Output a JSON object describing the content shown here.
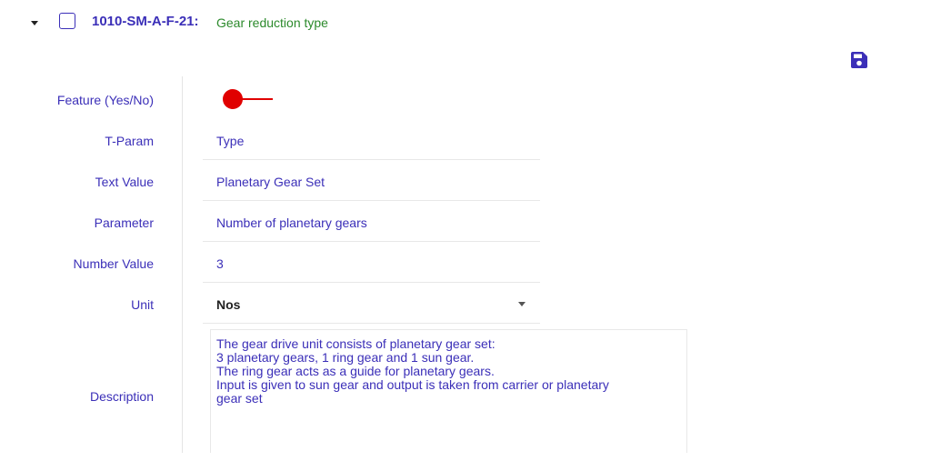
{
  "header": {
    "code": "1010-SM-A-F-21:",
    "title": "Gear reduction type"
  },
  "icons": {
    "expand": "caret-down-icon",
    "save": "floppy-disk-icon"
  },
  "colors": {
    "accent": "#3b2fb8",
    "title_green": "#2c8a2c",
    "toggle_off": "#e00000"
  },
  "form": {
    "feature": {
      "label": "Feature (Yes/No)",
      "value": false
    },
    "t_param": {
      "label": "T-Param",
      "value": "Type"
    },
    "text_value": {
      "label": "Text Value",
      "value": "Planetary Gear Set"
    },
    "parameter": {
      "label": "Parameter",
      "value": "Number of planetary gears"
    },
    "number_value": {
      "label": "Number Value",
      "value": "3"
    },
    "unit": {
      "label": "Unit",
      "value": "Nos"
    },
    "description": {
      "label": "Description",
      "value": "The gear drive unit consists of planetary gear set:\n3 planetary gears, 1 ring gear and 1 sun gear.\nThe ring gear acts as a guide for planetary gears.\nInput is given to sun gear and output is taken from carrier or planetary\ngear set"
    }
  }
}
